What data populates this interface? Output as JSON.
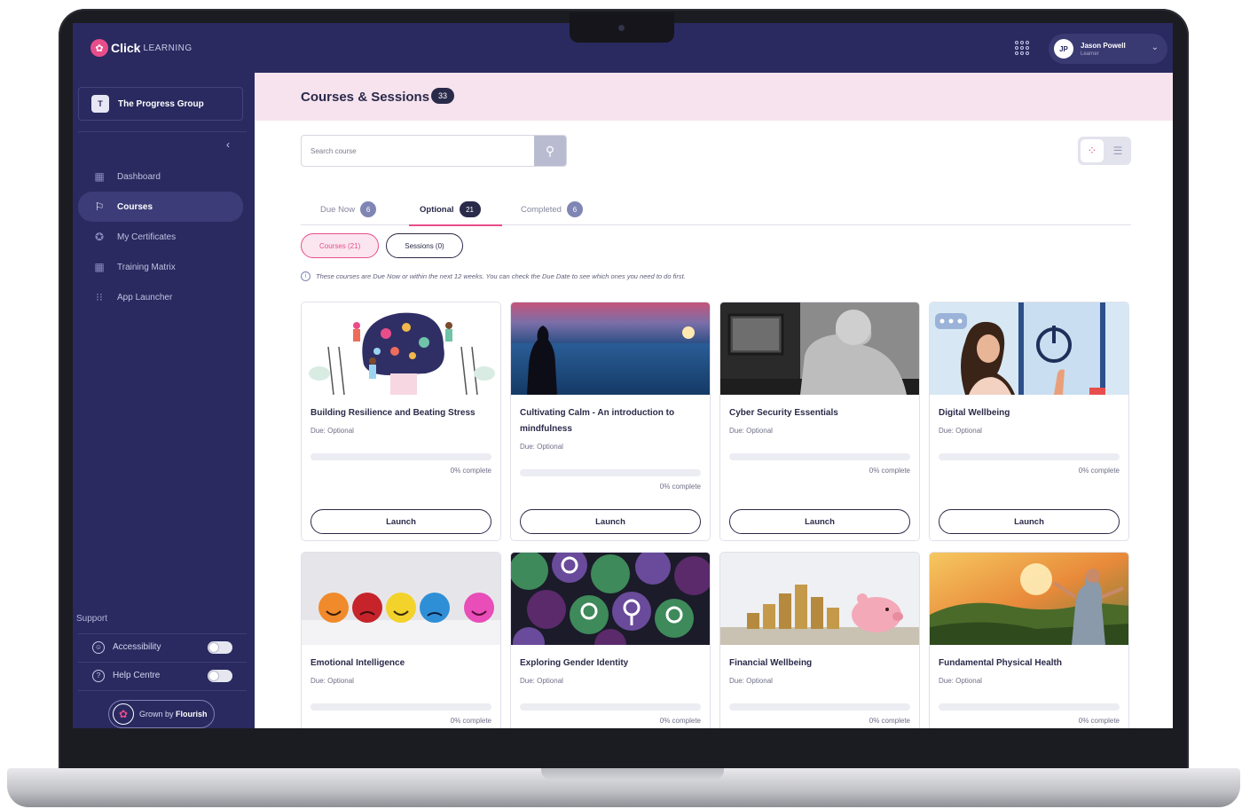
{
  "app": {
    "logo_bold": "Click",
    "logo_light": "LEARNING"
  },
  "user": {
    "initials": "JP",
    "name": "Jason Powell",
    "role": "Learner"
  },
  "sidebar": {
    "org_initial": "T",
    "org_name": "The Progress Group",
    "items": [
      {
        "label": "Dashboard",
        "icon": "dashboard-icon",
        "glyph": "▦",
        "active": false
      },
      {
        "label": "Courses",
        "icon": "graduation-cap-icon",
        "glyph": "🎓",
        "active": true
      },
      {
        "label": "My Certificates",
        "icon": "certificate-icon",
        "glyph": "✪",
        "active": false
      },
      {
        "label": "Training Matrix",
        "icon": "matrix-icon",
        "glyph": "▦",
        "active": false
      },
      {
        "label": "App Launcher",
        "icon": "app-launcher-icon",
        "glyph": "⁝⁝⁝",
        "active": false
      }
    ],
    "support_label": "Support",
    "support_items": [
      {
        "label": "Accessibility",
        "icon": "accessibility-icon"
      },
      {
        "label": "Help Centre",
        "icon": "help-icon"
      }
    ],
    "flourish_prefix": "Grown by ",
    "flourish_brand": "Flourish"
  },
  "main": {
    "title": "Courses & Sessions",
    "count": "33",
    "search": {
      "placeholder": "Search course"
    },
    "tabs": [
      {
        "label": "Due Now",
        "count": "6"
      },
      {
        "label": "Optional",
        "count": "21"
      },
      {
        "label": "Completed",
        "count": "6"
      }
    ],
    "filters": [
      {
        "label": "Courses (21)"
      },
      {
        "label": "Sessions (0)"
      }
    ],
    "info_note": "These courses are Due Now or within the next 12 weeks. You can check the Due Date to see which ones you need to do first."
  },
  "courses": [
    {
      "title": "Building Resilience and Beating Stress",
      "due": "Due: Optional",
      "progress_pct": 0,
      "progress_text": "0% complete",
      "button": "Launch"
    },
    {
      "title": "Cultivating Calm - An introduction to mindfulness",
      "due": "Due: Optional",
      "progress_pct": 0,
      "progress_text": "0% complete",
      "button": "Launch"
    },
    {
      "title": "Cyber Security Essentials",
      "due": "Due: Optional",
      "progress_pct": 0,
      "progress_text": "0% complete",
      "button": "Launch"
    },
    {
      "title": "Digital Wellbeing",
      "due": "Due: Optional",
      "progress_pct": 0,
      "progress_text": "0% complete",
      "button": "Launch"
    },
    {
      "title": "Emotional Intelligence",
      "due": "Due: Optional",
      "progress_pct": 0,
      "progress_text": "0% complete"
    },
    {
      "title": "Exploring Gender Identity",
      "due": "Due: Optional",
      "progress_pct": 0,
      "progress_text": "0% complete"
    },
    {
      "title": "Financial Wellbeing",
      "due": "Due: Optional",
      "progress_pct": 0,
      "progress_text": "0% complete"
    },
    {
      "title": "Fundamental Physical Health",
      "due": "Due: Optional",
      "progress_pct": 0,
      "progress_text": "0% complete"
    }
  ],
  "colors": {
    "navy": "#2a2a60",
    "accent_pink": "#e84d8a",
    "header_pink": "#f6e3ee",
    "badge_blue": "#7f86b4"
  }
}
